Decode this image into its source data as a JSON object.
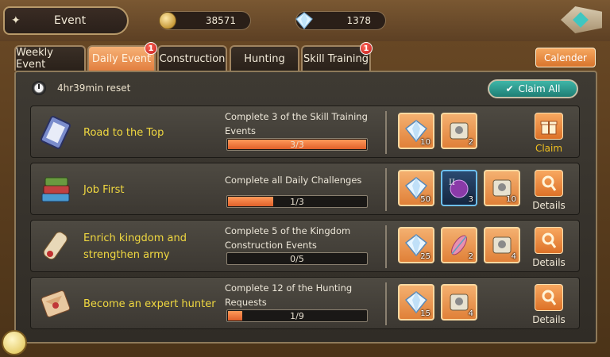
{
  "header": {
    "title": "Event",
    "gold": "38571",
    "gems": "1378"
  },
  "tabs": [
    {
      "label": "Weekly Event",
      "active": false,
      "badge": ""
    },
    {
      "label": "Daily Event",
      "active": true,
      "badge": "1"
    },
    {
      "label": "Construction",
      "active": false,
      "badge": ""
    },
    {
      "label": "Hunting",
      "active": false,
      "badge": ""
    },
    {
      "label": "Skill Training",
      "active": false,
      "badge": "1"
    }
  ],
  "calendar_label": "Calender",
  "reset_text": "4hr39min reset",
  "claim_all_label": "Claim All",
  "quests": [
    {
      "name": "Road to the Top",
      "description": "Complete 3 of the Skill Training Events",
      "progress_text": "3/3",
      "progress_fraction": 1.0,
      "rewards": [
        {
          "item": "crystal",
          "qty": "10"
        },
        {
          "item": "scroll",
          "qty": "2"
        }
      ],
      "action": "Claim"
    },
    {
      "name": "Job First",
      "description": "Complete all Daily Challenges",
      "progress_text": "1/3",
      "progress_fraction": 0.333,
      "rewards": [
        {
          "item": "crystal",
          "qty": "50"
        },
        {
          "item": "skill-orb",
          "qty": "3"
        },
        {
          "item": "scroll",
          "qty": "10"
        }
      ],
      "action": "Details"
    },
    {
      "name": "Enrich kingdom and strengthen army",
      "description": "Complete 5 of the Kingdom Construction Events",
      "progress_text": "0/5",
      "progress_fraction": 0.0,
      "rewards": [
        {
          "item": "crystal",
          "qty": "25"
        },
        {
          "item": "feather",
          "qty": "2"
        },
        {
          "item": "scroll",
          "qty": "4"
        }
      ],
      "action": "Details"
    },
    {
      "name": "Become an expert hunter",
      "description": "Complete 12 of the Hunting Requests",
      "progress_text": "1/9",
      "progress_fraction": 0.111,
      "rewards": [
        {
          "item": "crystal",
          "qty": "15"
        },
        {
          "item": "scroll",
          "qty": "4"
        }
      ],
      "action": "Details"
    }
  ],
  "colors": {
    "accent_orange": "#e27f3f",
    "quest_name": "#f0d840",
    "claim_teal": "#1f7e74"
  }
}
